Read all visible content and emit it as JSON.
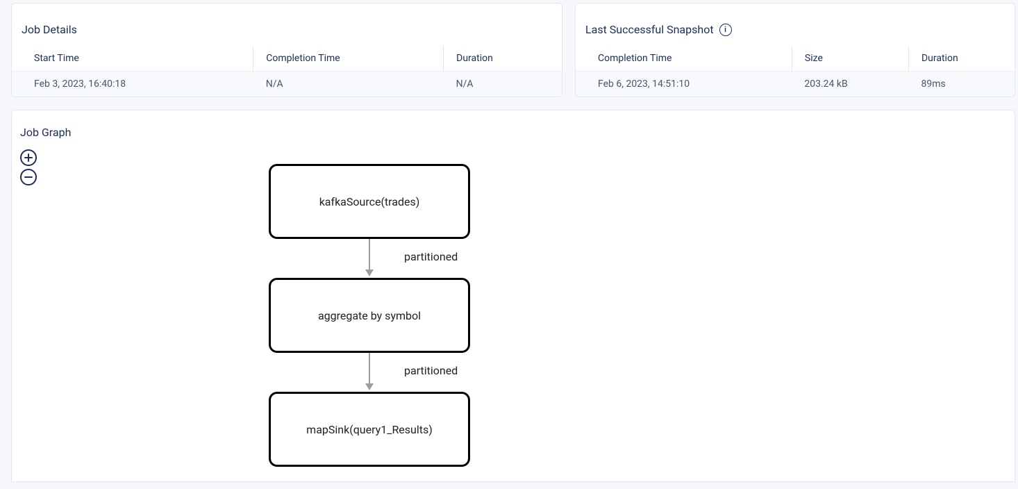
{
  "job_details": {
    "title": "Job Details",
    "columns": {
      "start_time": "Start Time",
      "completion_time": "Completion Time",
      "duration": "Duration"
    },
    "values": {
      "start_time": "Feb 3, 2023, 16:40:18",
      "completion_time": "N/A",
      "duration": "N/A"
    }
  },
  "snapshot": {
    "title": "Last Successful Snapshot",
    "info_icon_label": "i",
    "columns": {
      "completion_time": "Completion Time",
      "size": "Size",
      "duration": "Duration"
    },
    "values": {
      "completion_time": "Feb 6, 2023, 14:51:10",
      "size": "203.24 kB",
      "duration": "89ms"
    }
  },
  "graph": {
    "title": "Job Graph",
    "nodes": [
      "kafkaSource(trades)",
      "aggregate by symbol",
      "mapSink(query1_Results)"
    ],
    "edge_labels": [
      "partitioned",
      "partitioned"
    ]
  }
}
